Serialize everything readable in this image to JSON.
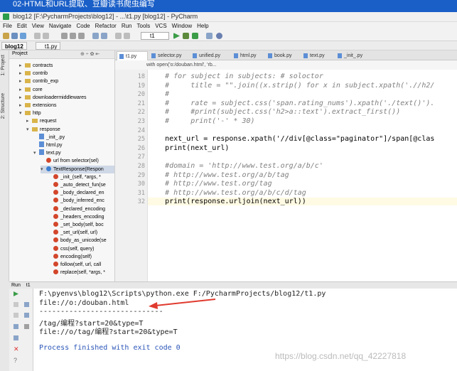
{
  "banner": {
    "text": "02-HTML和URL提取、豆瓣读书爬虫编写"
  },
  "window": {
    "title": "blog12 [F:\\PycharmProjects\\blog12] - ...\\t1.py [blog12] - PyCharm"
  },
  "menu": [
    "File",
    "Edit",
    "View",
    "Navigate",
    "Code",
    "Refactor",
    "Run",
    "Tools",
    "VCS",
    "Window",
    "Help"
  ],
  "toolbar": {
    "run_config": "t1"
  },
  "breadcrumbs": [
    "blog12",
    "t1.py"
  ],
  "project": {
    "header": "Project",
    "tree": [
      {
        "label": "contracts",
        "kind": "folder",
        "indent": 1,
        "arrow": "▸"
      },
      {
        "label": "contrib",
        "kind": "folder",
        "indent": 1,
        "arrow": "▸"
      },
      {
        "label": "contrib_exp",
        "kind": "folder",
        "indent": 1,
        "arrow": "▸"
      },
      {
        "label": "core",
        "kind": "folder",
        "indent": 1,
        "arrow": "▸"
      },
      {
        "label": "downloadermiddlewares",
        "kind": "folder",
        "indent": 1,
        "arrow": "▸"
      },
      {
        "label": "extensions",
        "kind": "folder",
        "indent": 1,
        "arrow": "▸"
      },
      {
        "label": "http",
        "kind": "folder",
        "indent": 1,
        "arrow": "▾"
      },
      {
        "label": "request",
        "kind": "folder",
        "indent": 2,
        "arrow": "▸"
      },
      {
        "label": "response",
        "kind": "folder",
        "indent": 2,
        "arrow": "▾"
      },
      {
        "label": "_init_.py",
        "kind": "py",
        "indent": 3,
        "arrow": ""
      },
      {
        "label": "html.py",
        "kind": "py",
        "indent": 3,
        "arrow": ""
      },
      {
        "label": "text.py",
        "kind": "py",
        "indent": 3,
        "arrow": "▾"
      },
      {
        "label": "url from selector(sel)",
        "kind": "method",
        "indent": 4,
        "arrow": ""
      },
      {
        "label": "TextResponse(Respon",
        "kind": "class",
        "indent": 4,
        "arrow": "▾"
      },
      {
        "label": "_init_(self, *args, *",
        "kind": "method",
        "indent": 5,
        "arrow": ""
      },
      {
        "label": "_auto_detect_fun(se",
        "kind": "method",
        "indent": 5,
        "arrow": ""
      },
      {
        "label": "_body_declared_en",
        "kind": "method",
        "indent": 5,
        "arrow": ""
      },
      {
        "label": "_body_inferred_enc",
        "kind": "method",
        "indent": 5,
        "arrow": ""
      },
      {
        "label": "_declared_encoding",
        "kind": "method",
        "indent": 5,
        "arrow": ""
      },
      {
        "label": "_headers_encoding",
        "kind": "method",
        "indent": 5,
        "arrow": ""
      },
      {
        "label": "_set_body(self, boc",
        "kind": "method",
        "indent": 5,
        "arrow": ""
      },
      {
        "label": "_set_url(self, url)",
        "kind": "method",
        "indent": 5,
        "arrow": ""
      },
      {
        "label": "body_as_unicode(se",
        "kind": "method",
        "indent": 5,
        "arrow": ""
      },
      {
        "label": "css(self, query)",
        "kind": "method",
        "indent": 5,
        "arrow": ""
      },
      {
        "label": "encoding(self)",
        "kind": "method",
        "indent": 5,
        "arrow": ""
      },
      {
        "label": "follow(self, url, call",
        "kind": "method",
        "indent": 5,
        "arrow": ""
      },
      {
        "label": "replace(self, *args, *",
        "kind": "method",
        "indent": 5,
        "arrow": ""
      }
    ]
  },
  "side_tabs": [
    "1: Project",
    "2: Structure"
  ],
  "tabs": [
    {
      "label": "t1.py",
      "active": true
    },
    {
      "label": "selector.py",
      "active": false
    },
    {
      "label": "unified.py",
      "active": false
    },
    {
      "label": "html.py",
      "active": false
    },
    {
      "label": "book.py",
      "active": false
    },
    {
      "label": "text.py",
      "active": false
    },
    {
      "label": "_init_.py",
      "active": false
    }
  ],
  "editor": {
    "context": "with open('o:/douban.html', 'rb...",
    "lines": [
      {
        "n": "18",
        "text": "    # for subject in subjects: # soloctor",
        "cls": "cmt"
      },
      {
        "n": "19",
        "text": "    #     title = \"\".join((x.strip() for x in subject.xpath('.//h2/",
        "cls": "cmt"
      },
      {
        "n": "20",
        "text": "    #",
        "cls": "cmt"
      },
      {
        "n": "21",
        "text": "    #     rate = subject.css('span.rating_nums').xpath('./text()').",
        "cls": "cmt"
      },
      {
        "n": "22",
        "text": "    #     #print(subject.css('h2>a::text').extract_first())",
        "cls": "cmt"
      },
      {
        "n": "23",
        "text": "    #     print('-' * 30)",
        "cls": "cmt"
      },
      {
        "n": "24",
        "text": "",
        "cls": ""
      },
      {
        "n": "25",
        "text": "    next_url = response.xpath('//div[@class=\"paginator\"]/span[@clas",
        "cls": ""
      },
      {
        "n": "26",
        "text": "    print(next_url)",
        "cls": ""
      },
      {
        "n": "27",
        "text": "",
        "cls": ""
      },
      {
        "n": "28",
        "text": "    #domain = 'http://www.test.org/a/b/c'",
        "cls": "cmt"
      },
      {
        "n": "29",
        "text": "    # http://www.test.org/a/b/tag",
        "cls": "cmt"
      },
      {
        "n": "30",
        "text": "    # http://www.test.org/tag",
        "cls": "cmt"
      },
      {
        "n": "31",
        "text": "    # http://www.test.org/a/b/c/d/tag",
        "cls": "cmt"
      },
      {
        "n": "32",
        "text": "    print(response.urljoin(next_url))",
        "cls": "cur"
      }
    ]
  },
  "run": {
    "label": "Run",
    "config": "t1",
    "lines": [
      {
        "text": "F:\\pyenvs\\blog12\\Scripts\\python.exe F:/PycharmProjects/blog12/t1.py",
        "cls": ""
      },
      {
        "text": "file://o:/douban.html",
        "cls": ""
      },
      {
        "text": "-----------------------------",
        "cls": ""
      },
      {
        "text": "/tag/编程?start=20&type=T",
        "cls": ""
      },
      {
        "text": "file://o/tag/编程?start=20&type=T",
        "cls": ""
      },
      {
        "text": "",
        "cls": ""
      },
      {
        "text": "Process finished with exit code 0",
        "cls": "blue"
      }
    ]
  },
  "watermark": "https://blog.csdn.net/qq_42227818",
  "colors": {
    "banner": "#1a5fc8",
    "accent_arrow": "#e03a2e",
    "comment": "#808080",
    "process": "#2a55b8"
  }
}
